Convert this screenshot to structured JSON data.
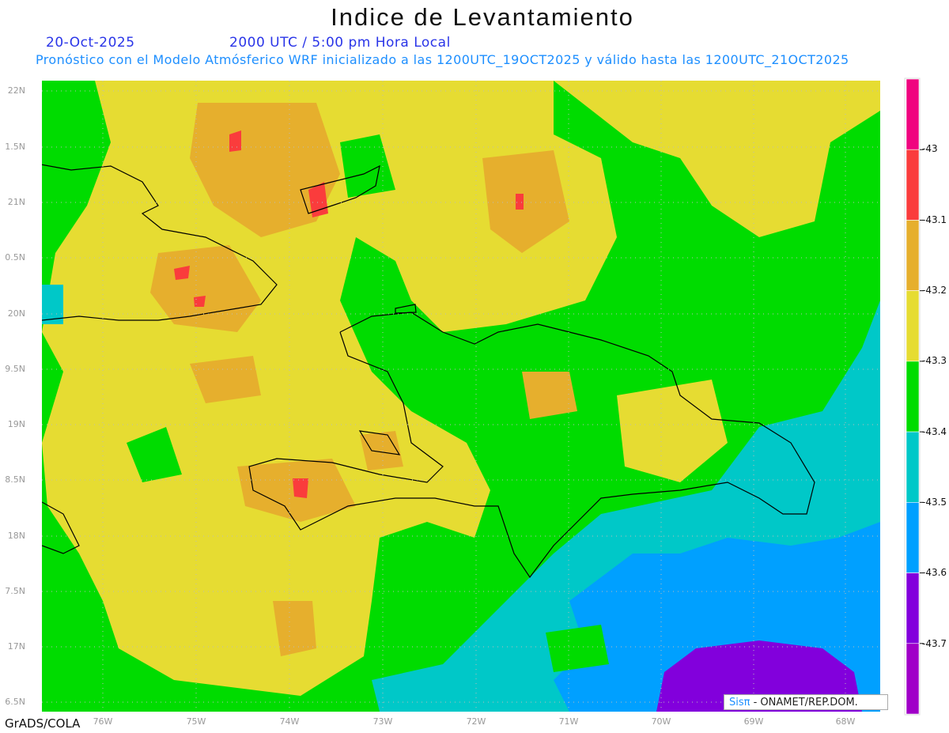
{
  "header": {
    "title": "Indice de Levantamiento",
    "date": "20-Oct-2025",
    "time": "2000 UTC / 5:00 pm Hora Local",
    "subtitle": "Pronóstico con el Modelo Atmósferico WRF inicializado a las 1200UTC_19OCT2025 y válido hasta las  1200UTC_21OCT2025"
  },
  "axes": {
    "lat_labels": [
      "22N",
      "1.5N",
      "21N",
      "0.5N",
      "20N",
      "9.5N",
      "19N",
      "8.5N",
      "18N",
      "7.5N",
      "17N",
      "6.5N"
    ],
    "lon_labels": [
      "76W",
      "75W",
      "74W",
      "73W",
      "72W",
      "71W",
      "70W",
      "69W",
      "68W"
    ]
  },
  "colorbar": {
    "labels": [
      "-43",
      "-43.1",
      "-43.2",
      "-43.3",
      "-43.4",
      "-43.5",
      "-43.6",
      "-43.7"
    ],
    "colors": [
      "#f0047f",
      "#fa3c3c",
      "#e6af2d",
      "#e6dc32",
      "#00dc00",
      "#00c8c8",
      "#00a0ff",
      "#8200dc",
      "#a000c8"
    ]
  },
  "footer": {
    "software": "GrADS/COLA",
    "credit_logo": "Sisπ",
    "credit_text": " - ONAMET/REP.DOM."
  }
}
